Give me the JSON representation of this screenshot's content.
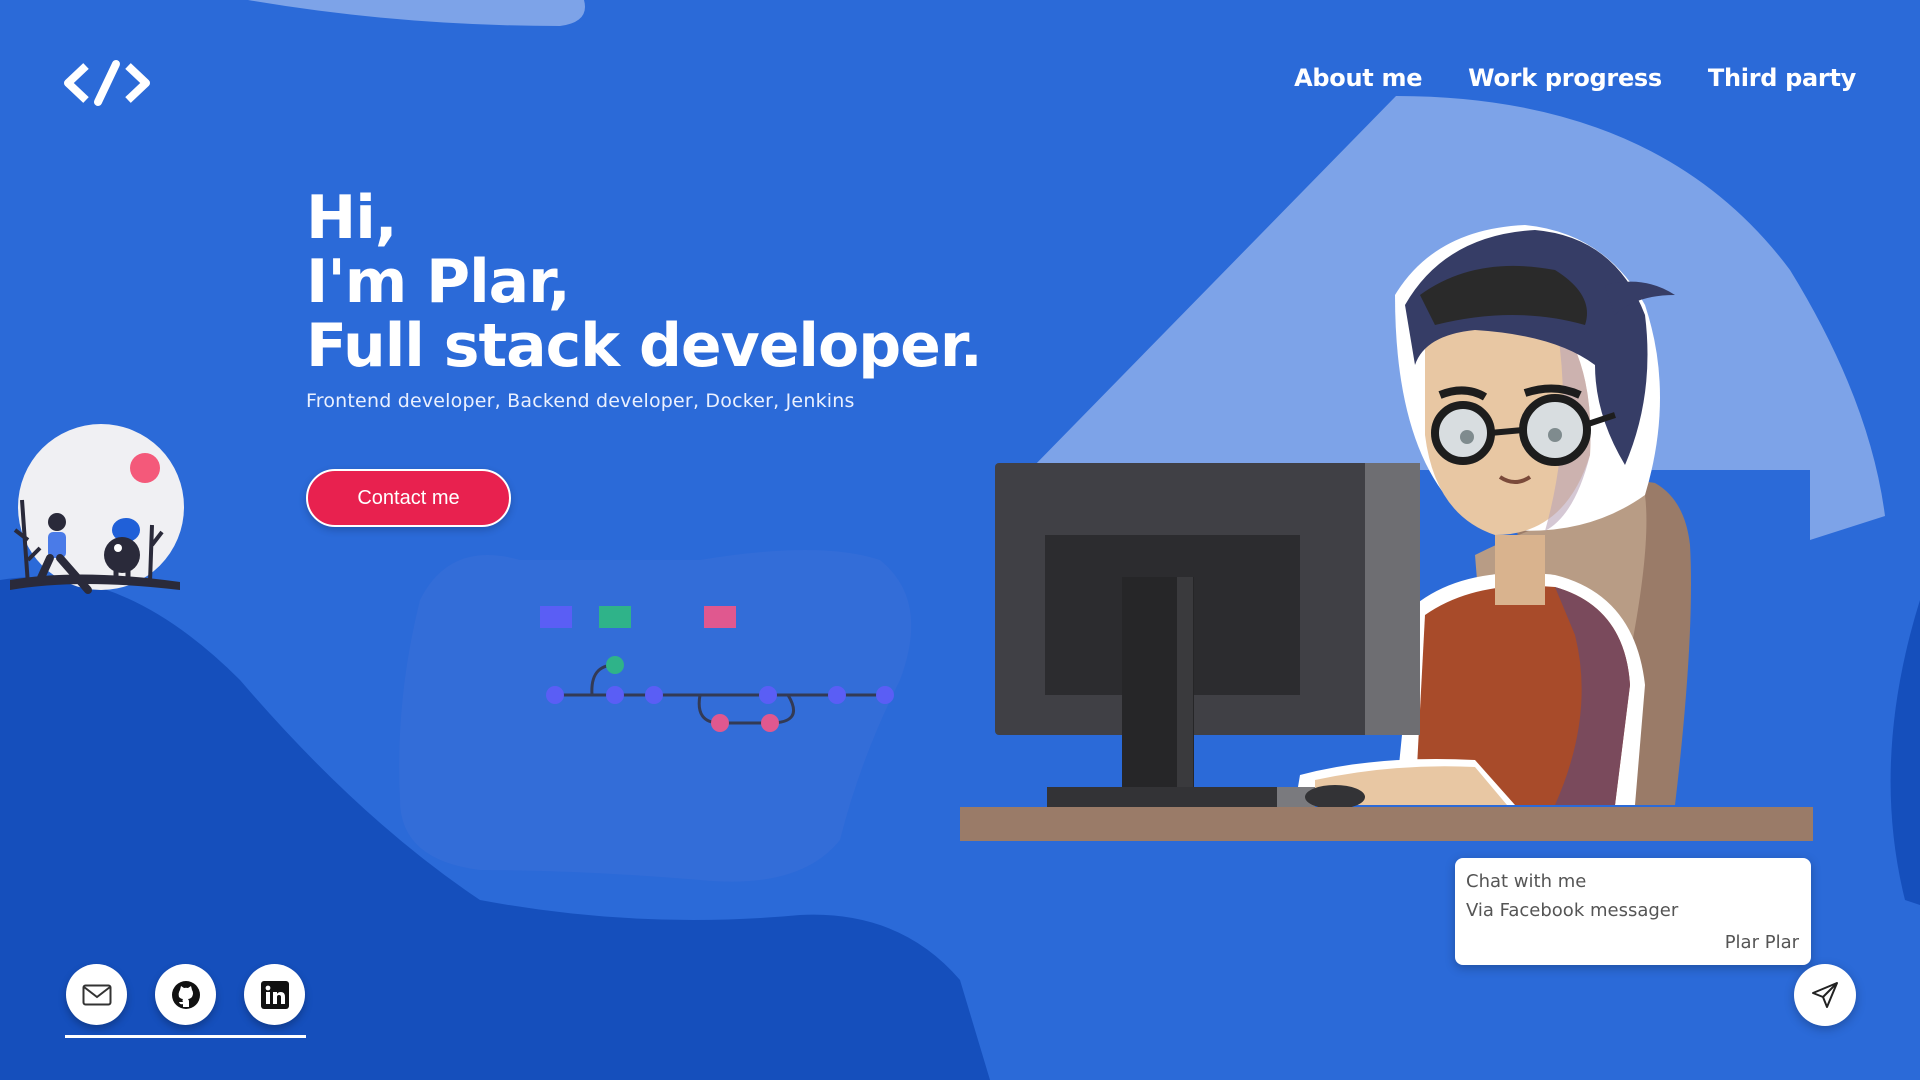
{
  "header": {
    "logo_icon": "code-brackets-icon",
    "nav": [
      {
        "label": "About me"
      },
      {
        "label": "Work progress"
      },
      {
        "label": "Third party"
      }
    ]
  },
  "hero": {
    "line1": "Hi,",
    "line2": "I'm Plar,",
    "line3": "Full stack developer.",
    "subtitle": "Frontend developer, Backend developer, Docker, Jenkins",
    "cta_label": "Contact me"
  },
  "socials": [
    {
      "icon": "mail-icon"
    },
    {
      "icon": "github-icon"
    },
    {
      "icon": "linkedin-icon"
    }
  ],
  "chat": {
    "line1": "Chat with me",
    "line2": "Via Facebook messager",
    "signature": "Plar Plar",
    "send_icon": "send-icon"
  },
  "colors": {
    "background": "#2b6ad8",
    "accent": "#e8214f",
    "light_blob": "#7da3e8"
  }
}
